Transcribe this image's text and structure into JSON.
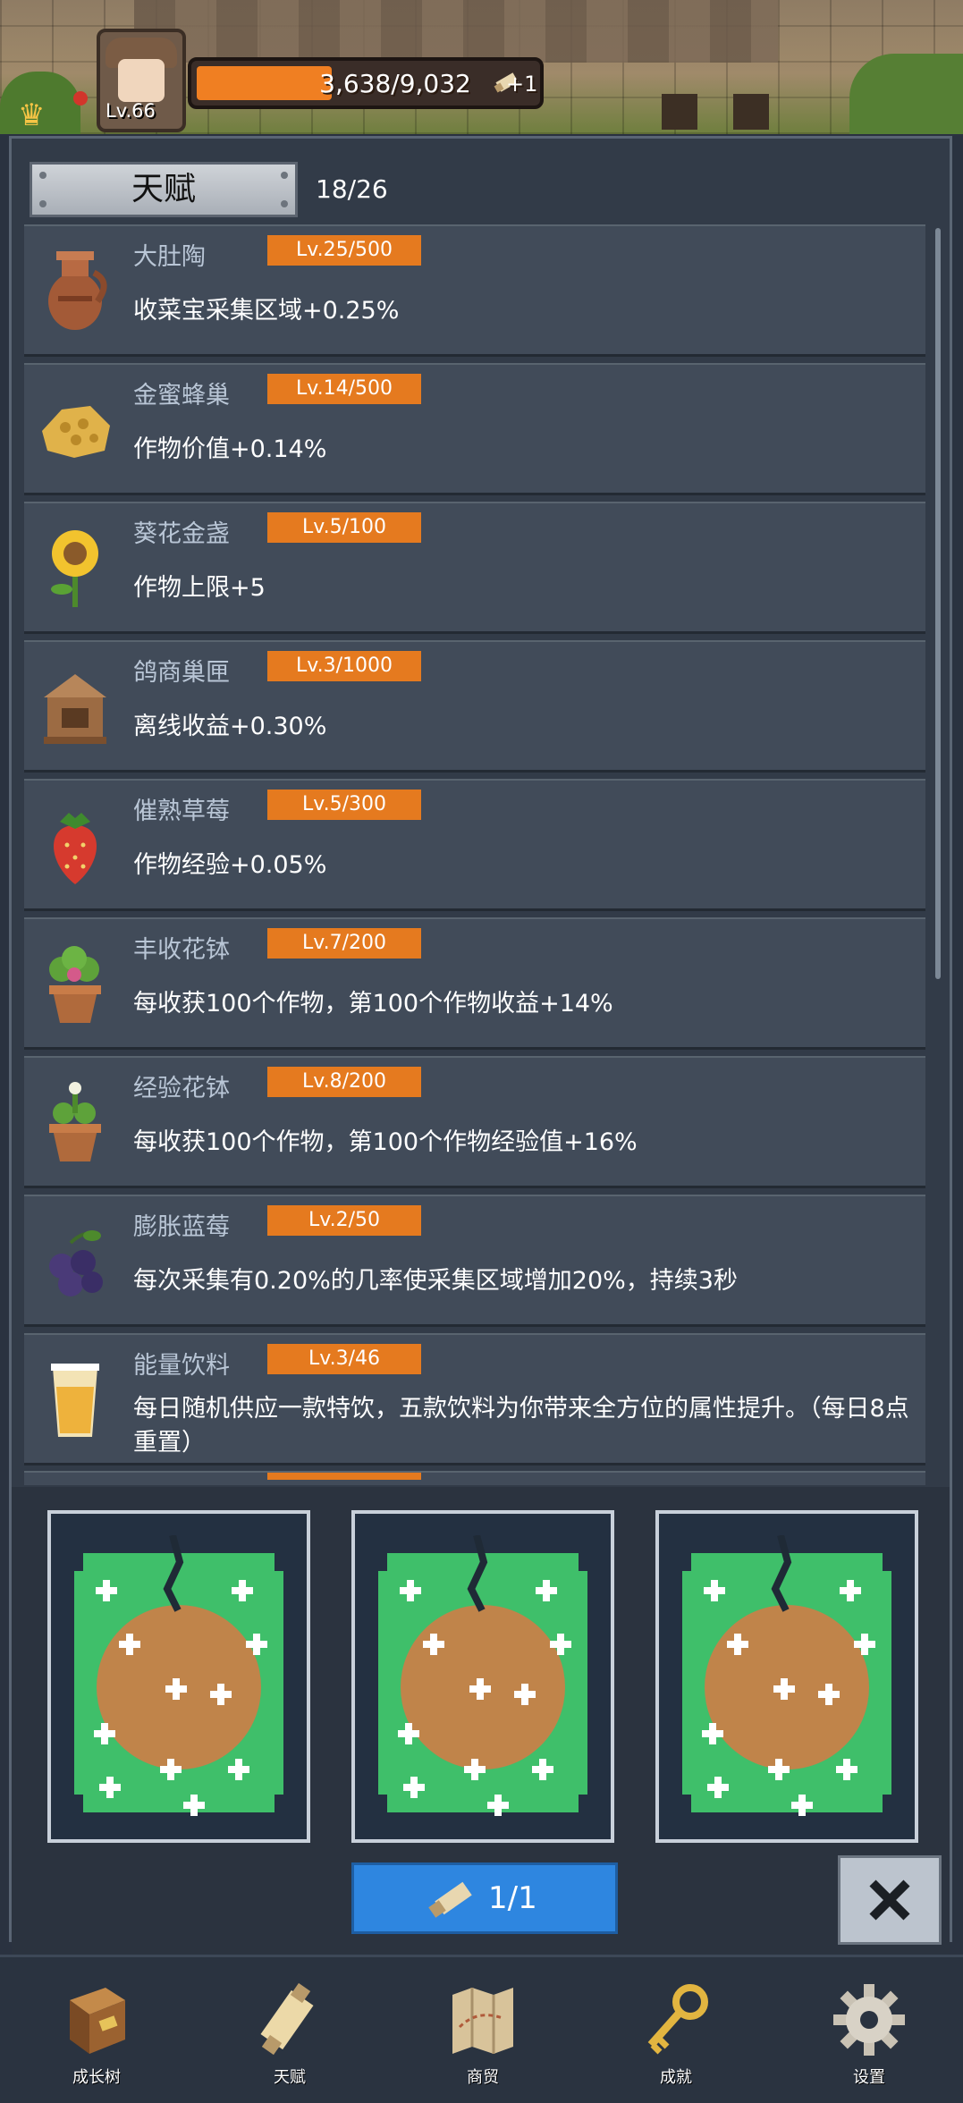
{
  "player": {
    "level": "Lv.66"
  },
  "xp": {
    "text": "3,638/9,032",
    "fraction": 0.4,
    "bonus": "+1"
  },
  "panel": {
    "tab_label": "天赋",
    "count": "18/26"
  },
  "talents": [
    {
      "icon": "clay-jar-icon",
      "name": "大肚陶",
      "level": "Lv.25/500",
      "desc": "收菜宝采集区域+0.25%"
    },
    {
      "icon": "honeycomb-icon",
      "name": "金蜜蜂巢",
      "level": "Lv.14/500",
      "desc": "作物价值+0.14%"
    },
    {
      "icon": "sunflower-icon",
      "name": "葵花金盏",
      "level": "Lv.5/100",
      "desc": "作物上限+5"
    },
    {
      "icon": "pigeon-box-icon",
      "name": "鸽商巢匣",
      "level": "Lv.3/1000",
      "desc": "离线收益+0.30%"
    },
    {
      "icon": "strawberry-icon",
      "name": "催熟草莓",
      "level": "Lv.5/300",
      "desc": "作物经验+0.05%"
    },
    {
      "icon": "flower-pot-icon",
      "name": "丰收花钵",
      "level": "Lv.7/200",
      "desc": "每收获100个作物，第100个作物收益+14%"
    },
    {
      "icon": "exp-pot-icon",
      "name": "经验花钵",
      "level": "Lv.8/200",
      "desc": "每收获100个作物，第100个作物经验值+16%"
    },
    {
      "icon": "blueberry-icon",
      "name": "膨胀蓝莓",
      "level": "Lv.2/50",
      "desc": "每次采集有0.20%的几率使采集区域增加20%，持续3秒"
    },
    {
      "icon": "energy-drink-icon",
      "name": "能量饮料",
      "level": "Lv.3/46",
      "desc": "每日随机供应一款特饮，五款饮料为你带来全方位的属性提升。（每日8点重置）"
    }
  ],
  "reward_cards": [
    {
      "icon": "talent-card-icon"
    },
    {
      "icon": "talent-card-icon"
    },
    {
      "icon": "talent-card-icon"
    }
  ],
  "actions": {
    "use_label": "1/1",
    "close_icon": "close-icon"
  },
  "nav": [
    {
      "label": "成长树",
      "icon": "book-icon"
    },
    {
      "label": "天赋",
      "icon": "scroll-icon"
    },
    {
      "label": "商贸",
      "icon": "map-icon"
    },
    {
      "label": "成就",
      "icon": "key-icon"
    },
    {
      "label": "设置",
      "icon": "gear-icon"
    }
  ],
  "colors": {
    "accent_orange": "#e57a1f",
    "use_button_blue": "#2e86e0",
    "panel_bg": "#323b48",
    "item_bg": "#414b59",
    "card_green": "#3fbf6a",
    "card_brown": "#c0844a"
  }
}
